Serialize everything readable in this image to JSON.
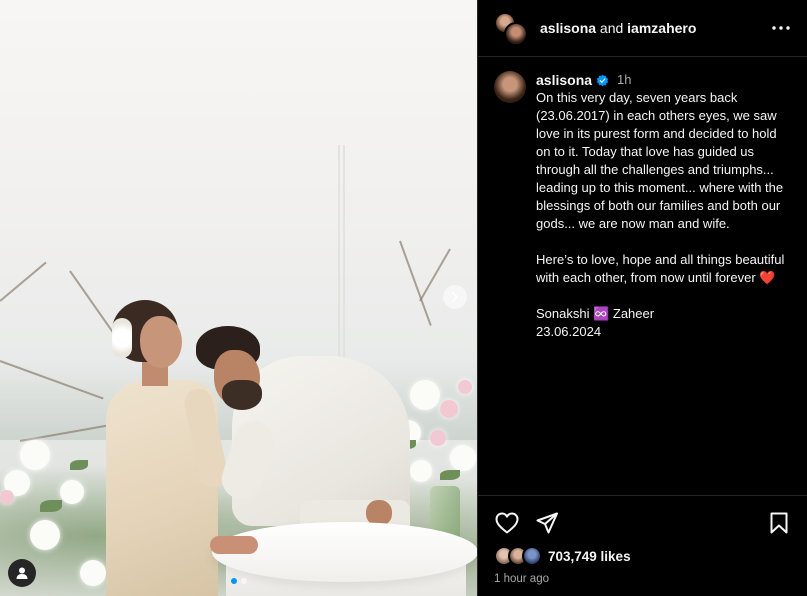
{
  "header": {
    "user1": "aslisona",
    "joiner": "and",
    "user2": "iamzahero"
  },
  "caption": {
    "username": "aslisona",
    "time": "1h",
    "text": "On this very day, seven years back (23.06.2017) in each others eyes, we saw love in its purest form and decided to hold on to it. Today that love has guided us through all the challenges and triumphs... leading up to this moment... where with the blessings of both our families and both our gods... we are now man and wife.\n\nHere’s to love, hope and all things beautiful with each other, from now until forever ❤️\n\nSonakshi ♾️ Zaheer\n23.06.2024"
  },
  "engagement": {
    "likes": "703,749 likes",
    "time_ago": "1 hour ago"
  },
  "icons": [
    "more-icon",
    "verified-icon",
    "heart-icon",
    "share-icon",
    "bookmark-icon",
    "next-icon",
    "user-tag-icon"
  ],
  "carousel": {
    "current": 1,
    "total": 2
  },
  "colors": {
    "accent": "#0095f6",
    "background": "#000000",
    "muted": "#a8a8a8"
  }
}
